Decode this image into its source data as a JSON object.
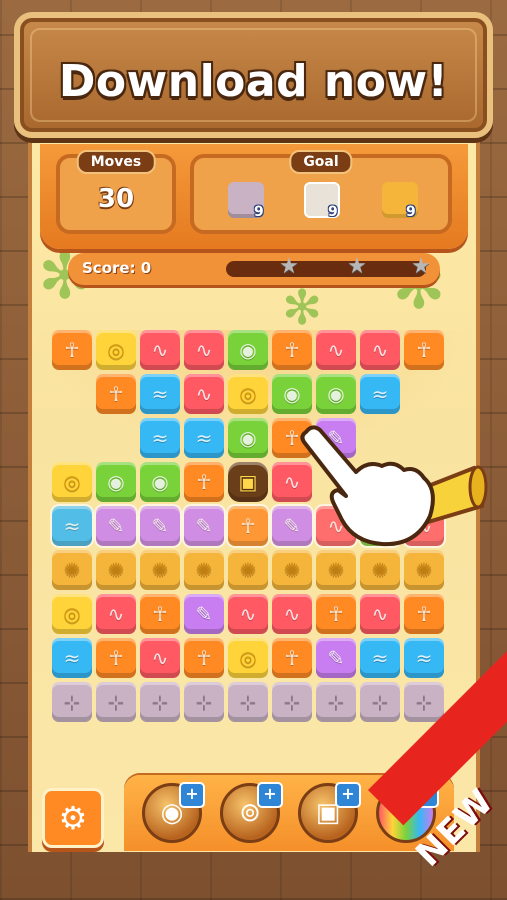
{
  "banner": {
    "title": "Download now!"
  },
  "hud": {
    "moves_label": "Moves",
    "moves_value": "30",
    "goal_label": "Goal",
    "goals": [
      {
        "icon": "stone-block-icon",
        "count": "9"
      },
      {
        "icon": "ice-block-icon",
        "count": "9"
      },
      {
        "icon": "sand-block-icon",
        "count": "9"
      }
    ],
    "score_label": "Score: 0",
    "score_progress": 0
  },
  "board": {
    "rows": [
      [
        "orange",
        "yellow",
        "red",
        "red",
        "green",
        "orange",
        "red",
        "red",
        "orange"
      ],
      [
        "",
        "orange",
        "blue",
        "red",
        "yellow",
        "green",
        "green",
        "blue",
        ""
      ],
      [
        "",
        "",
        "blue",
        "blue",
        "green",
        "orange",
        "purple",
        "",
        ""
      ],
      [
        "yellow",
        "green",
        "green",
        "orange",
        "jar",
        "red",
        "",
        "",
        ""
      ],
      [
        "blue-ice",
        "purple-ice",
        "purple-ice",
        "purple-ice",
        "orange-ice",
        "purple-ice",
        "red-ice",
        "green-ice",
        "red-ice"
      ],
      [
        "sand",
        "sand",
        "sand",
        "sand",
        "sand",
        "sand",
        "sand",
        "sand",
        "sand"
      ],
      [
        "yellow",
        "red",
        "orange",
        "purple",
        "red",
        "red",
        "orange",
        "red",
        "orange"
      ],
      [
        "blue",
        "orange",
        "red",
        "orange",
        "yellow",
        "orange",
        "purple",
        "blue",
        "blue"
      ],
      [
        "stone",
        "stone",
        "stone",
        "stone",
        "stone",
        "stone",
        "stone",
        "stone",
        "stone"
      ]
    ]
  },
  "boosters": [
    {
      "icon": "hammer-icon"
    },
    {
      "icon": "swap-icon"
    },
    {
      "icon": "jar-bomb-icon"
    },
    {
      "icon": "rainbow-icon"
    }
  ],
  "corner_ribbon": "NEW",
  "colors": {
    "accent": "#ff8a24",
    "banner": "#a8672d",
    "ribbon": "#e8241f"
  }
}
